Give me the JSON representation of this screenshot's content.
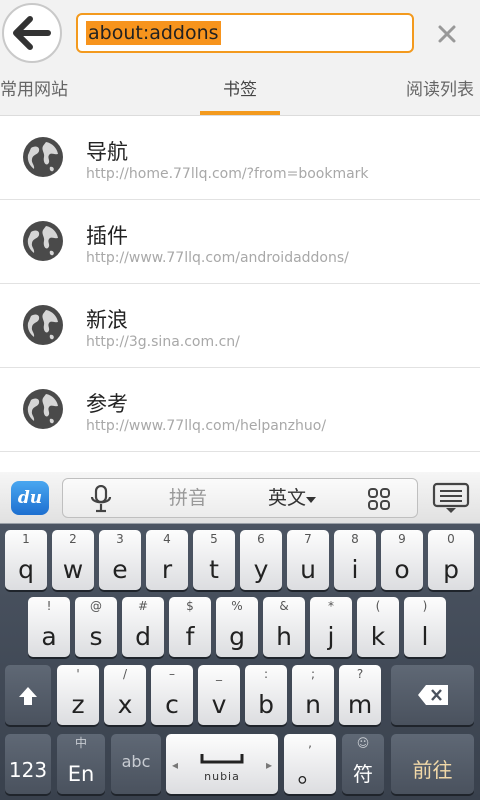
{
  "url_bar": {
    "address": "about:addons"
  },
  "tabs": [
    {
      "label": "常用网站",
      "active": false
    },
    {
      "label": "书签",
      "active": true
    },
    {
      "label": "阅读列表",
      "active": false
    }
  ],
  "bookmarks": [
    {
      "title": "导航",
      "url": "http://home.77llq.com/?from=bookmark"
    },
    {
      "title": "插件",
      "url": "http://www.77llq.com/androidaddons/"
    },
    {
      "title": "新浪",
      "url": "http://3g.sina.com.cn/"
    },
    {
      "title": "参考",
      "url": "http://www.77llq.com/helpanzhuo/"
    }
  ],
  "keyboard": {
    "logo_text": "du",
    "pinyin_label": "拼音",
    "english_label": "英文",
    "row1": [
      {
        "main": "q",
        "sub": "1"
      },
      {
        "main": "w",
        "sub": "2"
      },
      {
        "main": "e",
        "sub": "3"
      },
      {
        "main": "r",
        "sub": "4"
      },
      {
        "main": "t",
        "sub": "5"
      },
      {
        "main": "y",
        "sub": "6"
      },
      {
        "main": "u",
        "sub": "7"
      },
      {
        "main": "i",
        "sub": "8"
      },
      {
        "main": "o",
        "sub": "9"
      },
      {
        "main": "p",
        "sub": "0"
      }
    ],
    "row2": [
      {
        "main": "a",
        "sub": "!"
      },
      {
        "main": "s",
        "sub": "@"
      },
      {
        "main": "d",
        "sub": "#"
      },
      {
        "main": "f",
        "sub": "$"
      },
      {
        "main": "g",
        "sub": "%"
      },
      {
        "main": "h",
        "sub": "&"
      },
      {
        "main": "j",
        "sub": "*"
      },
      {
        "main": "k",
        "sub": "("
      },
      {
        "main": "l",
        "sub": ")"
      }
    ],
    "row3": [
      {
        "main": "z",
        "sub": "'"
      },
      {
        "main": "x",
        "sub": "/"
      },
      {
        "main": "c",
        "sub": "–"
      },
      {
        "main": "v",
        "sub": "_"
      },
      {
        "main": "b",
        "sub": ":"
      },
      {
        "main": "n",
        "sub": ";"
      },
      {
        "main": "m",
        "sub": "?"
      }
    ],
    "numbers_key": "123",
    "lang_key_top": "中",
    "lang_key_main": "En",
    "abc_key": "abc",
    "space_left": "◂",
    "space_brand": "nubia",
    "space_right": "▸",
    "period_sub": ",",
    "period_main": "。",
    "symbol_sub": "☺",
    "symbol_main": "符",
    "enter_key": "前往"
  },
  "colors": {
    "accent": "#f39a1e",
    "highlight": "#f7941d"
  }
}
